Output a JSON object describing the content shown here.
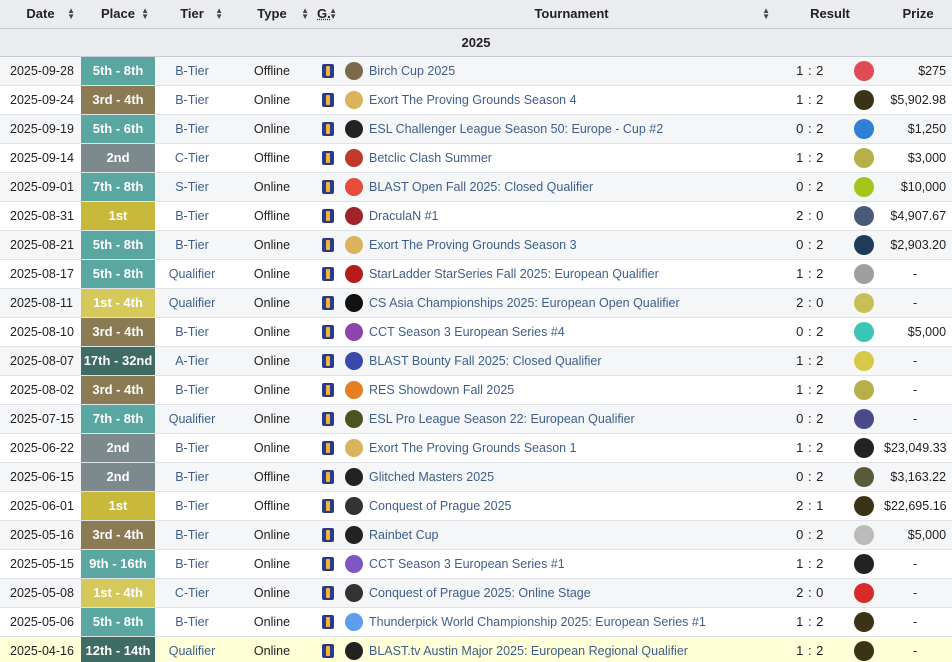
{
  "headers": {
    "date": "Date",
    "place": "Place",
    "tier": "Tier",
    "type": "Type",
    "game": "G.",
    "tournament": "Tournament",
    "result": "Result",
    "prize": "Prize"
  },
  "year": "2025",
  "rows": [
    {
      "date": "2025-09-28",
      "place": "5th - 8th",
      "tier": "B-Tier",
      "type": "Offline",
      "tournament": "Birch Cup 2025",
      "result": "1 : 2",
      "prize": "$275"
    },
    {
      "date": "2025-09-24",
      "place": "3rd - 4th",
      "tier": "B-Tier",
      "type": "Online",
      "tournament": "Exort The Proving Grounds Season 4",
      "result": "1 : 2",
      "prize": "$5,902.98"
    },
    {
      "date": "2025-09-19",
      "place": "5th - 6th",
      "tier": "B-Tier",
      "type": "Online",
      "tournament": "ESL Challenger League Season 50: Europe - Cup #2",
      "result": "0 : 2",
      "prize": "$1,250"
    },
    {
      "date": "2025-09-14",
      "place": "2nd",
      "tier": "C-Tier",
      "type": "Offline",
      "tournament": "Betclic Clash Summer",
      "result": "1 : 2",
      "prize": "$3,000"
    },
    {
      "date": "2025-09-01",
      "place": "7th - 8th",
      "tier": "S-Tier",
      "type": "Online",
      "tournament": "BLAST Open Fall 2025: Closed Qualifier",
      "result": "0 : 2",
      "prize": "$10,000"
    },
    {
      "date": "2025-08-31",
      "place": "1st",
      "tier": "B-Tier",
      "type": "Offline",
      "tournament": "DraculaN #1",
      "result": "2 : 0",
      "prize": "$4,907.67"
    },
    {
      "date": "2025-08-21",
      "place": "5th - 8th",
      "tier": "B-Tier",
      "type": "Online",
      "tournament": "Exort The Proving Grounds Season 3",
      "result": "0 : 2",
      "prize": "$2,903.20"
    },
    {
      "date": "2025-08-17",
      "place": "5th - 8th",
      "tier": "Qualifier",
      "type": "Online",
      "tournament": "StarLadder StarSeries Fall 2025: European Qualifier",
      "result": "1 : 2",
      "prize": "-"
    },
    {
      "date": "2025-08-11",
      "place": "1st - 4th",
      "tier": "Qualifier",
      "type": "Online",
      "tournament": "CS Asia Championships 2025: European Open Qualifier",
      "result": "2 : 0",
      "prize": "-"
    },
    {
      "date": "2025-08-10",
      "place": "3rd - 4th",
      "tier": "B-Tier",
      "type": "Online",
      "tournament": "CCT Season 3 European Series #4",
      "result": "0 : 2",
      "prize": "$5,000"
    },
    {
      "date": "2025-08-07",
      "place": "17th - 32nd",
      "tier": "A-Tier",
      "type": "Online",
      "tournament": "BLAST Bounty Fall 2025: Closed Qualifier",
      "result": "1 : 2",
      "prize": "-"
    },
    {
      "date": "2025-08-02",
      "place": "3rd - 4th",
      "tier": "B-Tier",
      "type": "Online",
      "tournament": "RES Showdown Fall 2025",
      "result": "1 : 2",
      "prize": "-"
    },
    {
      "date": "2025-07-15",
      "place": "7th - 8th",
      "tier": "Qualifier",
      "type": "Online",
      "tournament": "ESL Pro League Season 22: European Qualifier",
      "result": "0 : 2",
      "prize": "-"
    },
    {
      "date": "2025-06-22",
      "place": "2nd",
      "tier": "B-Tier",
      "type": "Online",
      "tournament": "Exort The Proving Grounds Season 1",
      "result": "1 : 2",
      "prize": "$23,049.33"
    },
    {
      "date": "2025-06-15",
      "place": "2nd",
      "tier": "B-Tier",
      "type": "Offline",
      "tournament": "Glitched Masters 2025",
      "result": "0 : 2",
      "prize": "$3,163.22"
    },
    {
      "date": "2025-06-01",
      "place": "1st",
      "tier": "B-Tier",
      "type": "Offline",
      "tournament": "Conquest of Prague 2025",
      "result": "2 : 1",
      "prize": "$22,695.16"
    },
    {
      "date": "2025-05-16",
      "place": "3rd - 4th",
      "tier": "B-Tier",
      "type": "Online",
      "tournament": "Rainbet Cup",
      "result": "0 : 2",
      "prize": "$5,000"
    },
    {
      "date": "2025-05-15",
      "place": "9th - 16th",
      "tier": "B-Tier",
      "type": "Online",
      "tournament": "CCT Season 3 European Series #1",
      "result": "1 : 2",
      "prize": "-"
    },
    {
      "date": "2025-05-08",
      "place": "1st - 4th",
      "tier": "C-Tier",
      "type": "Online",
      "tournament": "Conquest of Prague 2025: Online Stage",
      "result": "2 : 0",
      "prize": "-"
    },
    {
      "date": "2025-05-06",
      "place": "5th - 8th",
      "tier": "B-Tier",
      "type": "Online",
      "tournament": "Thunderpick World Championship 2025: European Series #1",
      "result": "1 : 2",
      "prize": "-"
    },
    {
      "date": "2025-04-16",
      "place": "12th - 14th",
      "tier": "Qualifier",
      "type": "Online",
      "tournament": "BLAST.tv Austin Major 2025: European Regional Qualifier",
      "result": "1 : 2",
      "prize": "-"
    }
  ],
  "colors": {
    "place_gold": "#c9b93b",
    "place_bronze": "#8a7b55",
    "place_teal": "#5aa6a0",
    "place_silver": "#7c8a8e",
    "place_dark": "#3e6b63",
    "link": "#3f5f8a",
    "highlight_row": "#ffffd8"
  }
}
